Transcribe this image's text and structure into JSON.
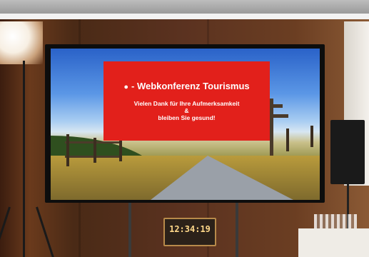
{
  "slide": {
    "title": "- Webkonferenz Tourismus",
    "line1": "Vielen Dank für Ihre Aufmerksamkeit",
    "line2": "&",
    "line3": "bleiben Sie gesund!"
  },
  "clock": {
    "time": "12:34:19"
  },
  "colors": {
    "slide_red": "#e2201b",
    "clock_digits": "#ffd98a"
  },
  "icons": {
    "logo": "sparkasse-icon"
  }
}
